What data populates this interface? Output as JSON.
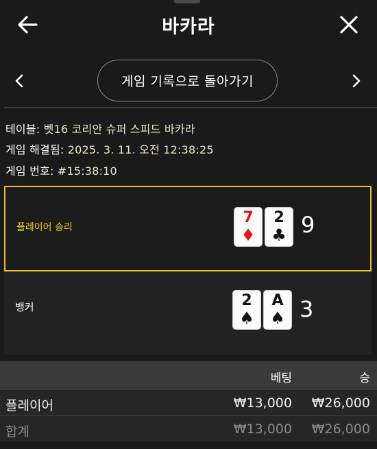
{
  "header": {
    "title": "바카라",
    "back_icon": "arrow-left-icon",
    "close_icon": "close-icon"
  },
  "nav": {
    "history_button_label": "게임 기록으로 돌아가기",
    "prev_icon": "chevron-left-icon",
    "next_icon": "chevron-right-icon"
  },
  "info": {
    "table_label": "테이블:",
    "table_value": "벳16 코리안 슈퍼 스피드 바카라",
    "resolved_label": "게임 해결됨:",
    "resolved_value": "2025. 3. 11. 오전 12:38:25",
    "number_label": "게임 번호:",
    "number_value": "#15:38:10"
  },
  "results": {
    "player": {
      "label": "플레이어 승리",
      "score": "9",
      "cards": [
        {
          "rank": "7",
          "suit": "♦",
          "color": "red"
        },
        {
          "rank": "2",
          "suit": "♣",
          "color": "black"
        }
      ]
    },
    "banker": {
      "label": "뱅커",
      "score": "3",
      "cards": [
        {
          "rank": "2",
          "suit": "♠",
          "color": "black"
        },
        {
          "rank": "A",
          "suit": "♠",
          "color": "black"
        }
      ]
    }
  },
  "bets_table": {
    "headers": {
      "label": "",
      "bet": "베팅",
      "win": "승"
    },
    "rows": [
      {
        "label": "플레이어",
        "bet": "₩13,000",
        "win": "₩26,000"
      },
      {
        "label": "합계",
        "bet": "₩13,000",
        "win": "₩26,000"
      }
    ]
  },
  "colors": {
    "accent_yellow": "#e6c416",
    "background": "#1a1a1a",
    "card_red": "#e3151b"
  }
}
